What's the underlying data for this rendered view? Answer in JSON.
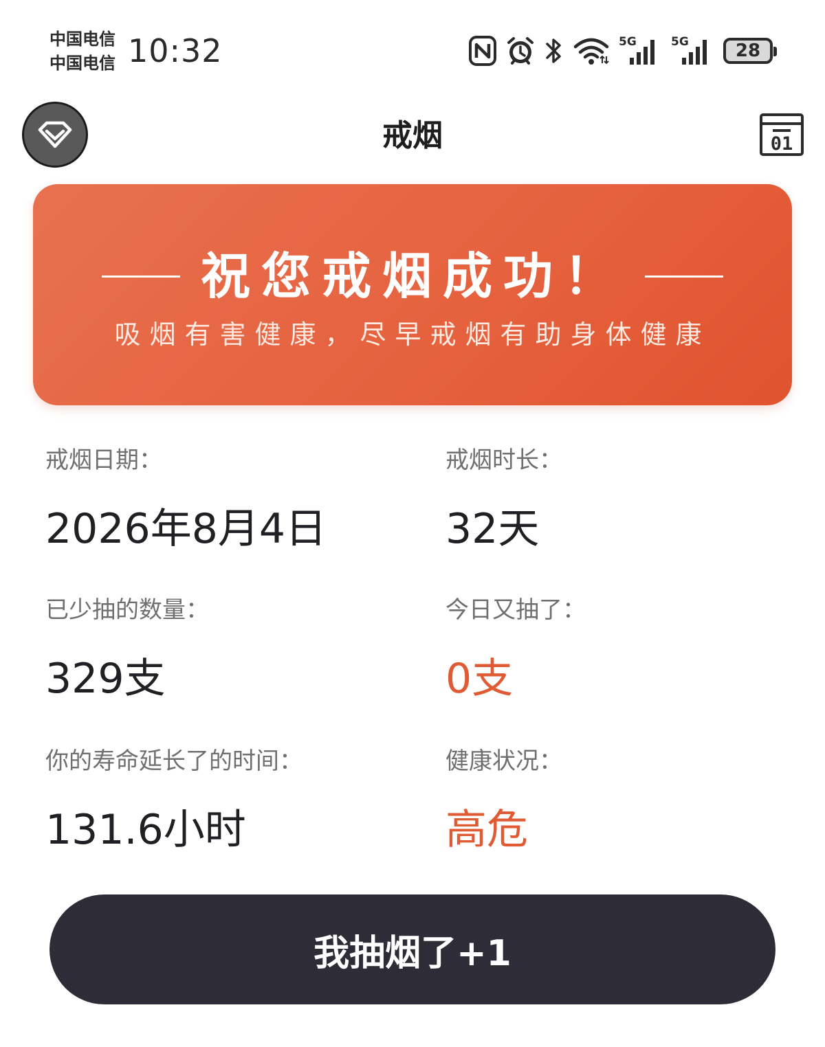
{
  "status_bar": {
    "carrier_1": "中国电信",
    "carrier_2": "中国电信",
    "time": "10:32",
    "network_1": "5G",
    "network_2": "5G",
    "battery_level": "28",
    "icons": [
      "nfc-icon",
      "alarm-icon",
      "bluetooth-icon",
      "wifi-icon",
      "signal-icon",
      "signal-icon",
      "battery-icon"
    ]
  },
  "header": {
    "title": "戒烟",
    "left_icon": "vip-diamond-icon",
    "right_icon": "calendar-icon",
    "calendar_icon_text": "01"
  },
  "banner": {
    "title": "祝您戒烟成功！",
    "subtitle": "吸烟有害健康，尽早戒烟有助身体健康",
    "gradient_start": "#e8714f",
    "gradient_end": "#e0532e"
  },
  "stats": {
    "quit_date": {
      "label": "戒烟日期：",
      "value": "2026年8月4日"
    },
    "quit_duration": {
      "label": "戒烟时长：",
      "value": "32天"
    },
    "cigarettes_avoided": {
      "label": "已少抽的数量：",
      "value": "329支"
    },
    "smoked_today": {
      "label": "今日又抽了：",
      "value": "0支"
    },
    "life_extended": {
      "label": "你的寿命延长了的时间：",
      "value": "131.6小时"
    },
    "health_status": {
      "label": "健康状况：",
      "value": "高危"
    }
  },
  "colors": {
    "accent": "#e05a33",
    "button_bg": "#2e2c36"
  },
  "action_button": {
    "label": "我抽烟了+1"
  }
}
